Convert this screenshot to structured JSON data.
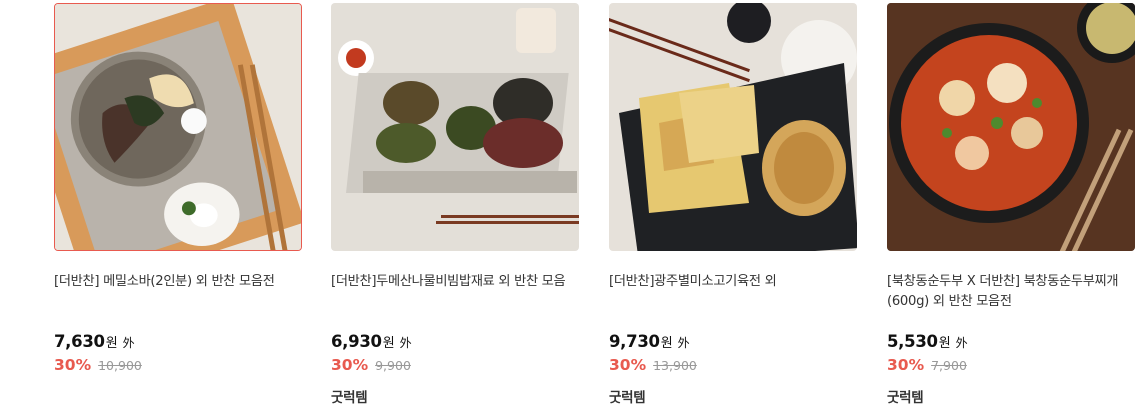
{
  "products": [
    {
      "title": "[더반찬] 메밀소바(2인분) 외 반찬 모음전",
      "price": "7,630",
      "currency": "원",
      "suffix": "外",
      "discount": "30%",
      "original_price": "10,900",
      "badge": ""
    },
    {
      "title": "[더반찬]두메산나물비빔밥재료 외 반찬 모음",
      "price": "6,930",
      "currency": "원",
      "suffix": "外",
      "discount": "30%",
      "original_price": "9,900",
      "badge": "굿럭템"
    },
    {
      "title": "[더반찬]광주별미소고기육전 외",
      "price": "9,730",
      "currency": "원",
      "suffix": "外",
      "discount": "30%",
      "original_price": "13,900",
      "badge": "굿럭템"
    },
    {
      "title": "[북창동순두부 X 더반찬] 북창동순두부찌개(600g) 외 반찬 모음전",
      "price": "5,530",
      "currency": "원",
      "suffix": "外",
      "discount": "30%",
      "original_price": "7,900",
      "badge": "굿럭템"
    }
  ],
  "colors": {
    "discount": "#e85a4f",
    "selected_border": "#e85a4f",
    "text": "#333333"
  }
}
